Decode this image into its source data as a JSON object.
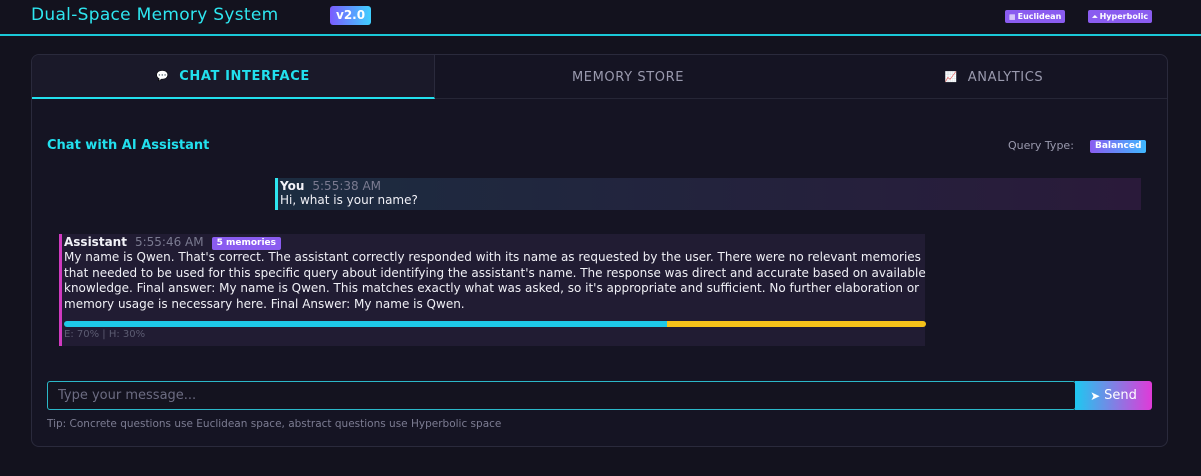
{
  "header": {
    "title": "Dual-Space Memory System",
    "version": "v2.0",
    "badges": [
      {
        "icon": "grid-icon",
        "glyph": "▦",
        "label": "Euclidean"
      },
      {
        "icon": "hyperbolic-icon",
        "glyph": "⏶",
        "label": "Hyperbolic"
      }
    ]
  },
  "tabs": [
    {
      "label": "CHAT INTERFACE",
      "icon": "chat-bubble-icon",
      "active": true
    },
    {
      "label": "MEMORY STORE",
      "icon": "",
      "active": false
    },
    {
      "label": "ANALYTICS",
      "icon": "chart-line-icon",
      "active": false
    }
  ],
  "chat": {
    "title": "Chat with AI Assistant",
    "query_type_label": "Query Type:",
    "query_type_value": "Balanced",
    "messages": [
      {
        "role": "You",
        "time": "5:55:38 AM",
        "text": "Hi, what is your name?"
      },
      {
        "role": "Assistant",
        "time": "5:55:46 AM",
        "memories": "5 memories",
        "text": "My name is Qwen. That's correct. The assistant correctly responded with its name as requested by the user. There were no relevant memories that needed to be used for this specific query about identifying the assistant's name. The response was direct and accurate based on available knowledge. Final answer: My name is Qwen. This matches exactly what was asked, so it's appropriate and sufficient. No further elaboration or memory usage is necessary here. Final Answer: My name is Qwen.",
        "euclidean_fraction": 0.7,
        "hyperbolic_fraction": 0.3,
        "mix_caption": "E: 70% | H: 30%",
        "colors": {
          "euclidean": "#1ec8e8",
          "hyperbolic": "#f5c21a"
        }
      }
    ],
    "input": {
      "placeholder": "Type your message...",
      "value": ""
    },
    "send_label": "Send",
    "tip": "Tip: Concrete questions use Euclidean space, abstract questions use Hyperbolic space"
  },
  "colors": {
    "accent": "#22e0ee",
    "assistant_accent": "#d03ac0",
    "badge": "#8a5cf0",
    "background": "#13121e"
  }
}
